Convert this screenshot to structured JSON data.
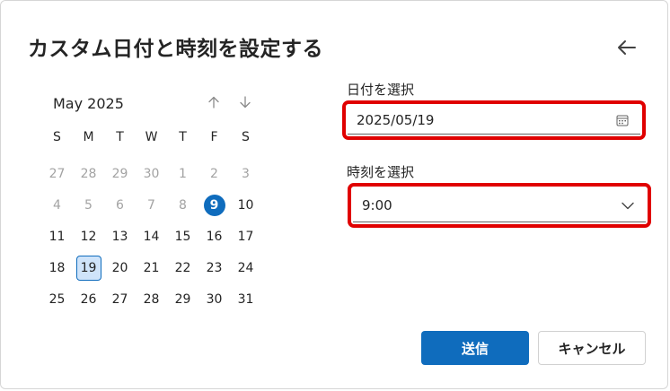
{
  "dialog": {
    "title": "カスタム日付と時刻を設定する",
    "back_icon": "arrow-left-icon"
  },
  "calendar": {
    "month_label": "May 2025",
    "prev_icon": "arrow-up-icon",
    "next_icon": "arrow-down-icon",
    "weekdays": [
      "S",
      "M",
      "T",
      "W",
      "T",
      "F",
      "S"
    ],
    "weeks": [
      [
        "27",
        "28",
        "29",
        "30",
        "1",
        "2",
        "3"
      ],
      [
        "4",
        "5",
        "6",
        "7",
        "8",
        "9",
        "10"
      ],
      [
        "11",
        "12",
        "13",
        "14",
        "15",
        "16",
        "17"
      ],
      [
        "18",
        "19",
        "20",
        "21",
        "22",
        "23",
        "24"
      ],
      [
        "25",
        "26",
        "27",
        "28",
        "29",
        "30",
        "31"
      ]
    ],
    "muted_cells": [
      "0-0",
      "0-1",
      "0-2",
      "0-3",
      "0-4",
      "0-5",
      "0-6",
      "1-0",
      "1-1",
      "1-2",
      "1-3",
      "1-4"
    ],
    "today_cell": "1-5",
    "selected_cell": "3-1"
  },
  "date_field": {
    "label": "日付を選択",
    "value": "2025/05/19",
    "icon": "calendar-icon"
  },
  "time_field": {
    "label": "時刻を選択",
    "value": "9:00",
    "icon": "chevron-down-icon"
  },
  "buttons": {
    "submit": "送信",
    "cancel": "キャンセル"
  },
  "colors": {
    "accent": "#0f6cbd",
    "highlight_border": "#e00000",
    "selected_bg": "#cfe4fa"
  }
}
